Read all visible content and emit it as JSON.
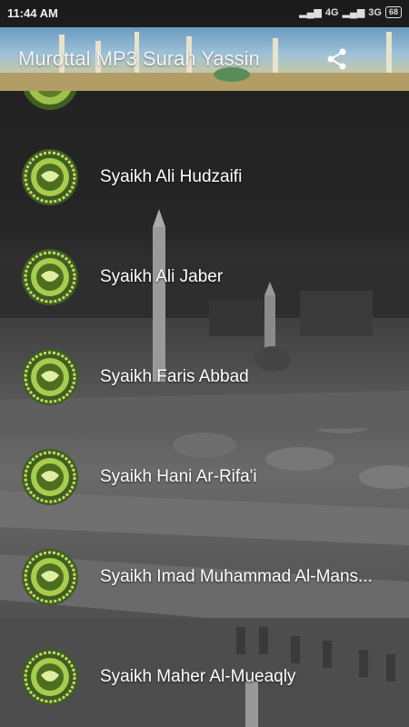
{
  "status": {
    "time": "11:44 AM",
    "network1": "4G",
    "network2": "3G",
    "battery": "68"
  },
  "appbar": {
    "title": "Murottal MP3 Surah Yassin"
  },
  "icons": {
    "share": "share-icon",
    "item": "quran-cover-icon"
  },
  "reciters": [
    "Syaikh Ali Hudzaifi",
    "Syaikh Ali Jaber",
    "Syaikh Faris Abbad",
    "Syaikh Hani Ar-Rifa'i",
    "Syaikh Imad Muhammad Al-Mans...",
    "Syaikh Maher Al-Mueaqly"
  ]
}
